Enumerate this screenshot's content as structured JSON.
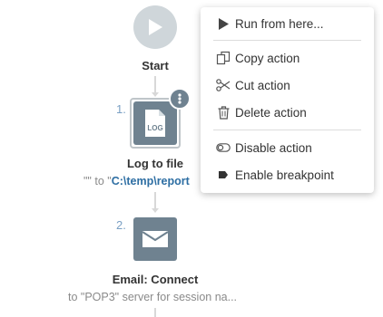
{
  "flow": {
    "start": {
      "label": "Start"
    },
    "steps": [
      {
        "number": "1.",
        "icon": "log-file-icon",
        "icon_text": "LOG",
        "title": "Log to file",
        "desc_prefix": "\"\" to \"",
        "desc_highlight": "C:\\temp\\report"
      },
      {
        "number": "2.",
        "icon": "envelope-icon",
        "title": "Email: Connect",
        "desc": "to \"POP3\" server for session na..."
      }
    ]
  },
  "context_menu": {
    "items": [
      {
        "label": "Run from here...",
        "icon": "play-icon"
      },
      {
        "label": "Copy action",
        "icon": "copy-icon"
      },
      {
        "label": "Cut action",
        "icon": "scissors-icon"
      },
      {
        "label": "Delete action",
        "icon": "trash-icon"
      },
      {
        "label": "Disable action",
        "icon": "toggle-icon"
      },
      {
        "label": "Enable breakpoint",
        "icon": "breakpoint-icon"
      }
    ]
  },
  "colors": {
    "tile": "#6f8290",
    "start_circle": "#cfd6da",
    "highlight_text": "#2d6ea3",
    "step_number": "#7aa0c4"
  }
}
